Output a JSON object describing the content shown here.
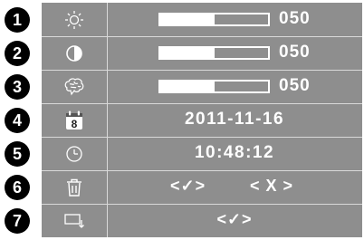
{
  "badges": [
    "1",
    "2",
    "3",
    "4",
    "5",
    "6",
    "7"
  ],
  "brightness": {
    "icon": "sun-icon",
    "value": "050",
    "level": 0.5
  },
  "contrast": {
    "icon": "contrast-icon",
    "value": "050",
    "level": 0.5
  },
  "saturation": {
    "icon": "brain-icon",
    "value": "050",
    "level": 0.5
  },
  "date": {
    "icon": "calendar-icon",
    "calendar_digit": "8",
    "value": "2011-11-16"
  },
  "time": {
    "icon": "clock-icon",
    "value": "10:48:12"
  },
  "delete": {
    "icon": "trash-icon",
    "confirm": "<✓>",
    "cancel": "< X >"
  },
  "exit": {
    "icon": "exit-icon",
    "confirm": "<✓>"
  },
  "colors": {
    "panel": "#8e8e8e",
    "lines": "#d9d9d9",
    "text": "#ffffff",
    "badge": "#000000"
  }
}
